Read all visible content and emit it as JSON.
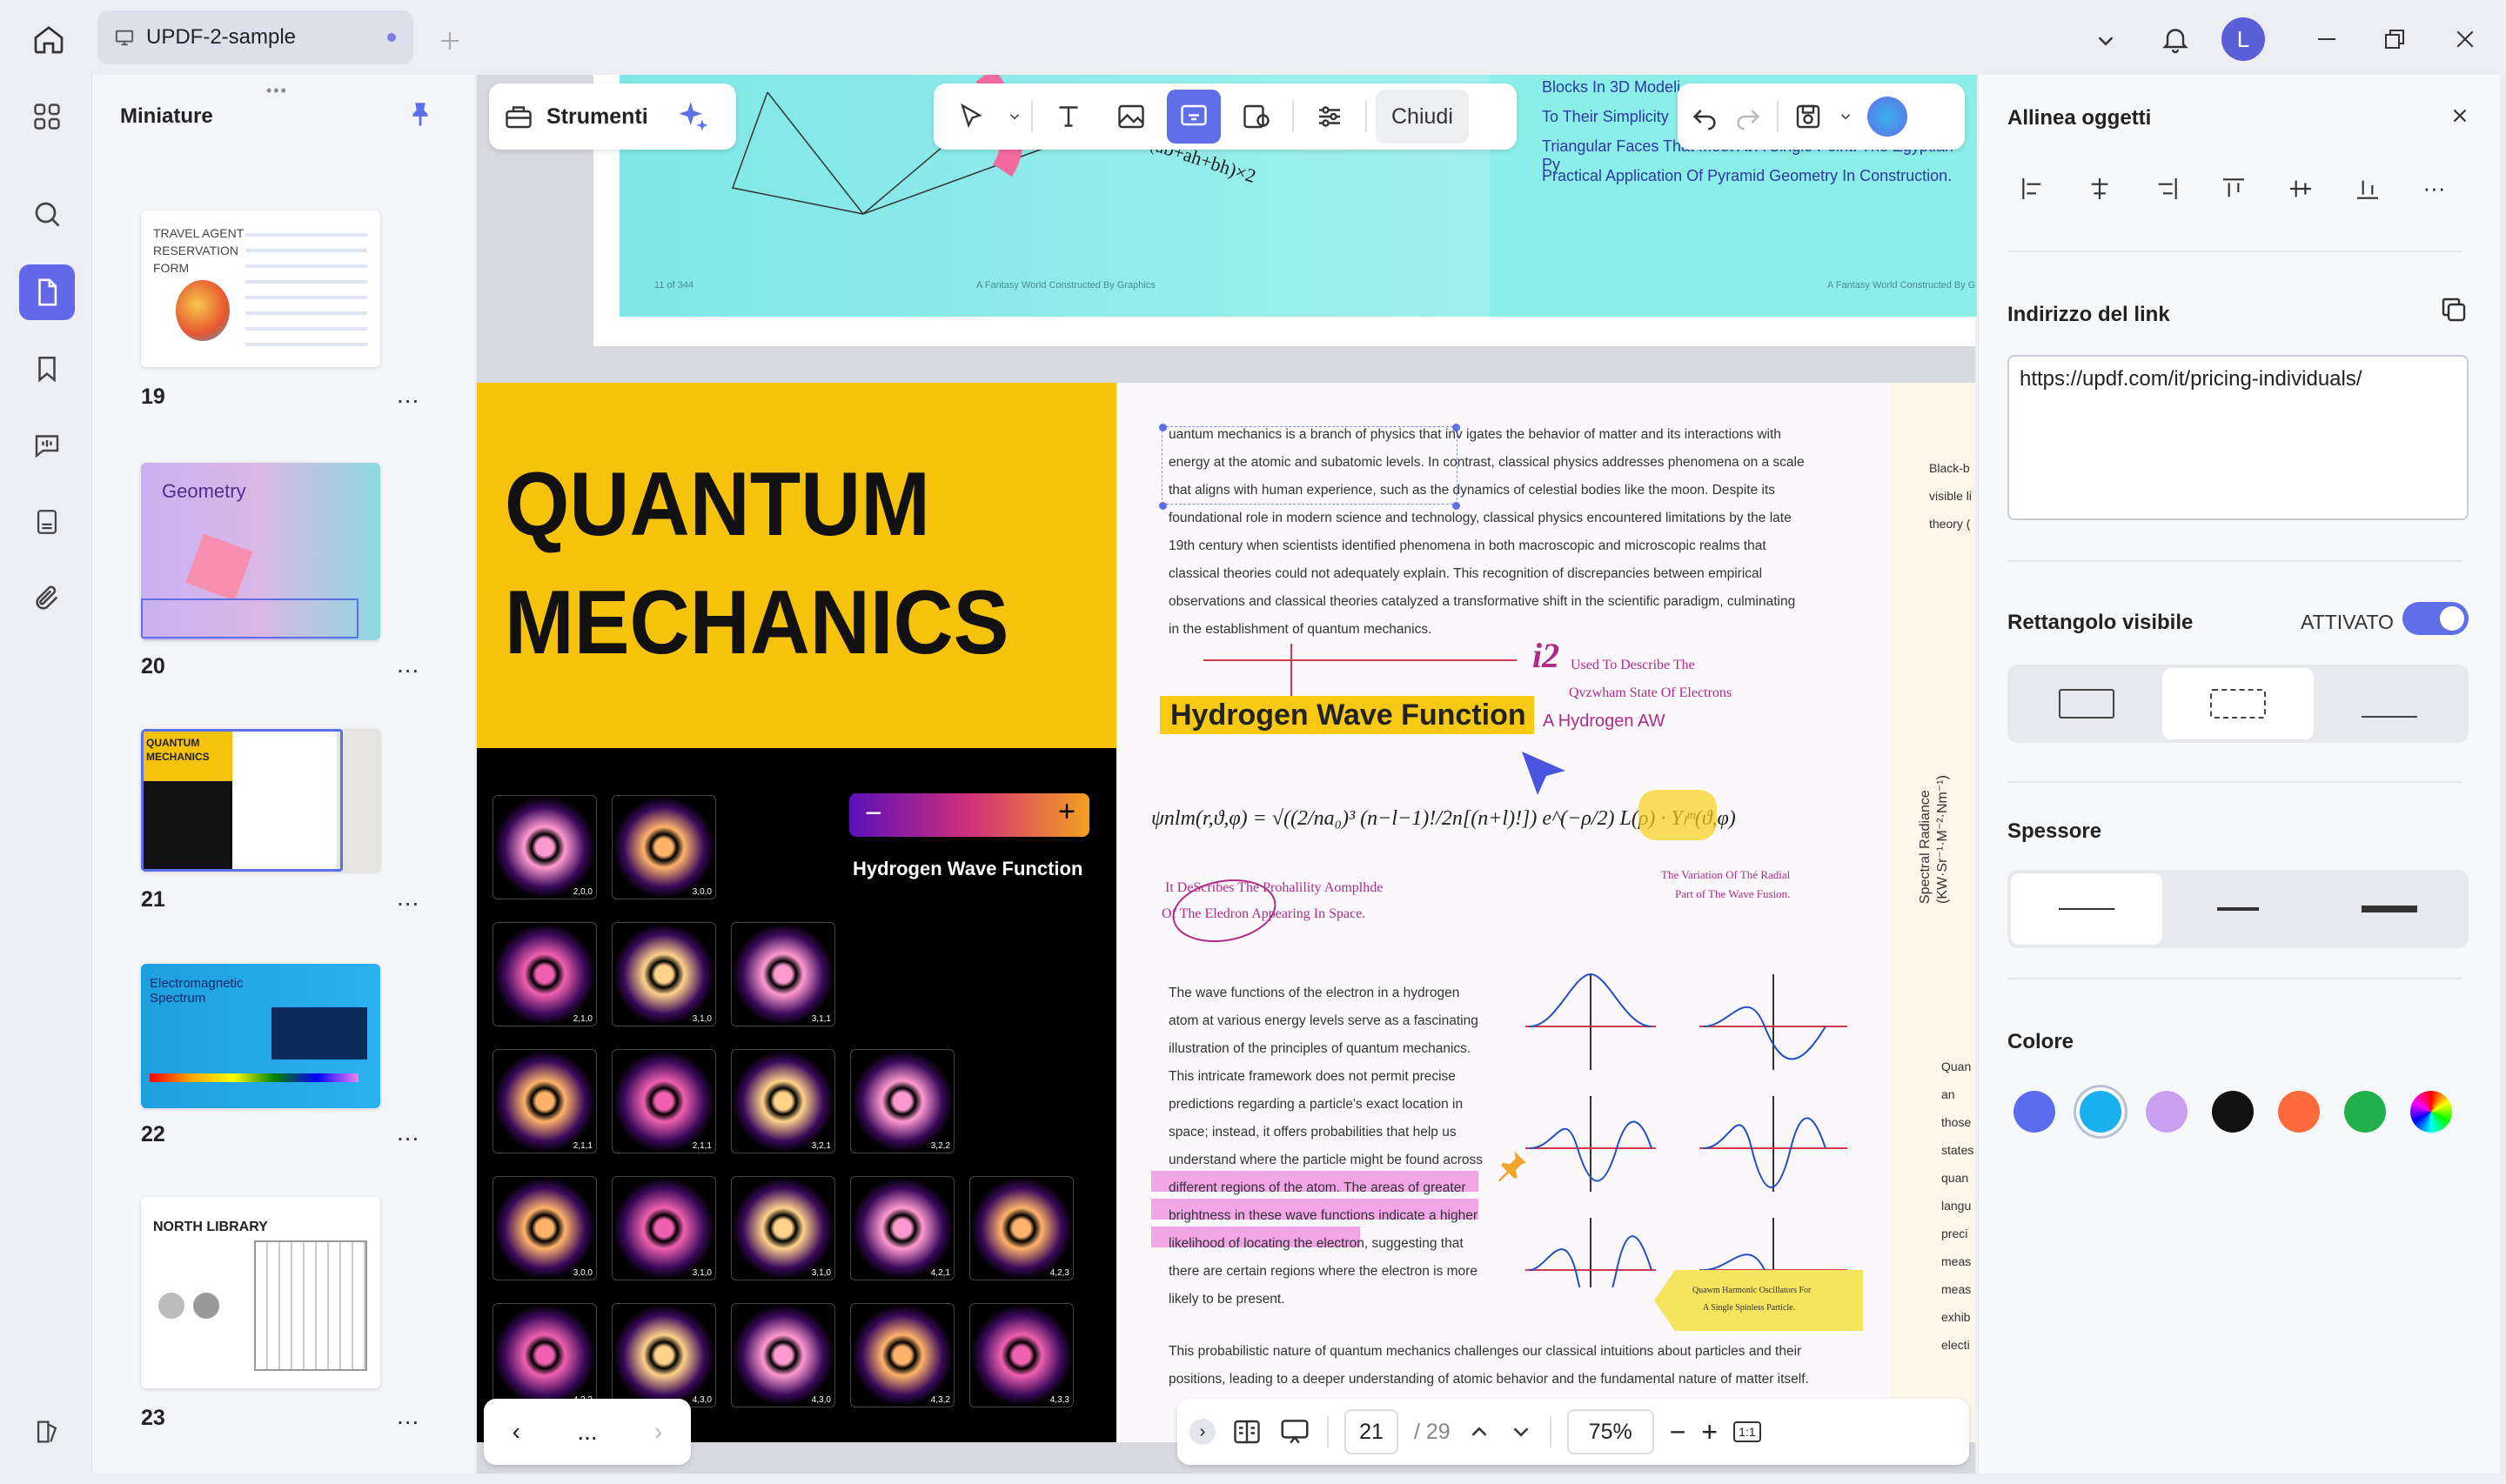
{
  "tab": {
    "title": "UPDF-2-sample"
  },
  "user": {
    "initial": "L"
  },
  "thumbs": {
    "title": "Miniature",
    "items": [
      {
        "num": "19",
        "label": "TRAVEL AGENT RESERVATION FORM"
      },
      {
        "num": "20",
        "label": "Geometry"
      },
      {
        "num": "21",
        "label": "QUANTUM MECHANICS"
      },
      {
        "num": "22",
        "label": "Electromagnetic Spectrum"
      },
      {
        "num": "23",
        "label": "NORTH LIBRARY"
      }
    ],
    "more": "..."
  },
  "toolbar": {
    "tools_label": "Strumenti",
    "close_label": "Chiudi"
  },
  "top_page": {
    "lines": [
      "Blocks In 3D Modeli",
      "To Their Simplicity",
      "Triangular Faces That Meet At A Single Point. The Egyptian Py",
      "Practical Application Of Pyramid Geometry In Construction."
    ],
    "footer_left": "11 of 344",
    "footer_mid": "A Fantasy World Constructed By Graphics",
    "footer_right": "A Fantasy World Constructed By G",
    "formula": "-(ab+ah+bh)×2"
  },
  "page": {
    "title_line1": "QUANTUM",
    "title_line2": "MECHANICS",
    "gradient_label": "Hydrogen Wave Function",
    "orb_labels": [
      "2,0,0",
      "3,0,0",
      "2,1,0",
      "3,1,0",
      "3,1,1",
      "2,1,1",
      "2,1,1",
      "3,2,1",
      "3,2,2",
      "3,0,0",
      "3,1,0",
      "3,1,0",
      "4,2,1",
      "4,2,3",
      "4,2,2",
      "4,3,0",
      "4,3,0",
      "4,3,2",
      "4,3,3"
    ],
    "intro": [
      "uantum mechanics is a branch of physics that inv igates the behavior of matter and its interactions with",
      "energy at the atomic and subatomic levels. In contrast, classical physics addresses phenomena on a scale",
      "that aligns with human experience, such as the dynamics of celestial bodies like the moon. Despite its",
      "foundational role in modern science and technology, classical physics encountered limitations by the late",
      "19th century when scientists identified phenomena in both macroscopic and microscopic realms that",
      "classical theories could not adequately explain. This recognition of discrepancies between empirical",
      "observations and classical theories catalyzed a transformative shift in the scientific paradigm, culminating",
      "in the establishment of quantum mechanics."
    ],
    "heading": "Hydrogen Wave Function",
    "annot_i2": "i2",
    "annot_used": "Used To Describe The",
    "annot_state": "Qvzwham State Of Electrons",
    "annot_haw": "A Hydrogen AW",
    "formula": "ψnlm(r,ϑ,φ) = √((2/na₀)³ (n−l−1)!/2n[(n+l)!]) e^(−ρ/2) L(ρ) · Yₗᵐ(ϑ,φ)",
    "annot_describes": "It DeScribes The Prohalility Aomplhde",
    "annot_electron": "Of The Eledron Appearing In Space.",
    "annot_variation": "The Variation Of Thé Radial",
    "annot_part": "Part of The Wave Fusion.",
    "body": [
      "The wave functions of the electron in a hydrogen",
      "atom at various energy levels serve as a fascinating",
      "illustration of the principles of quantum mechanics.",
      "This intricate framework does not permit precise",
      "predictions regarding a particle's exact location in",
      "space; instead, it offers probabilities that help us",
      "understand where the particle might be found across",
      "different regions of the atom. The areas of greater",
      "brightness in these wave functions indicate a higher",
      "likelihood of locating the electron, suggesting that",
      "there are certain regions where the electron is more",
      "likely to be present."
    ],
    "sticky_line1": "Quawm Harmonic Oscillators For",
    "sticky_line2": "A Single Spinless Particle.",
    "closing1": "This probabilistic nature of quantum mechanics challenges our classical intuitions about particles and their",
    "closing2": "positions, leading to a deeper understanding of atomic behavior and the fundamental nature of matter itself.",
    "strip_top": [
      "Black-b",
      "visible li",
      "theory ("
    ],
    "strip_axis": "Spectral Radiance (KW·Sr⁻¹·M⁻²·Nm⁻¹)",
    "strip_bottom": [
      "Quan",
      "an",
      "those",
      "states",
      "quan",
      "langu",
      "preci",
      "meas",
      "meas",
      "exhib",
      "electi"
    ]
  },
  "panel": {
    "align_title": "Allinea oggetti",
    "link_title": "Indirizzo del link",
    "link_value": "https://updf.com/it/pricing-individuals/",
    "rect_title": "Rettangolo visibile",
    "rect_state": "ATTIVATO",
    "thickness_title": "Spessore",
    "color_title": "Colore",
    "colors": [
      "#5b6cf0",
      "#1ab0f0",
      "#c9a0f0",
      "#111111",
      "#ff6a3c",
      "#22b04a",
      "rainbow"
    ]
  },
  "nav": {
    "page": "21",
    "total": "/ 29",
    "zoom": "75%",
    "more": "..."
  }
}
